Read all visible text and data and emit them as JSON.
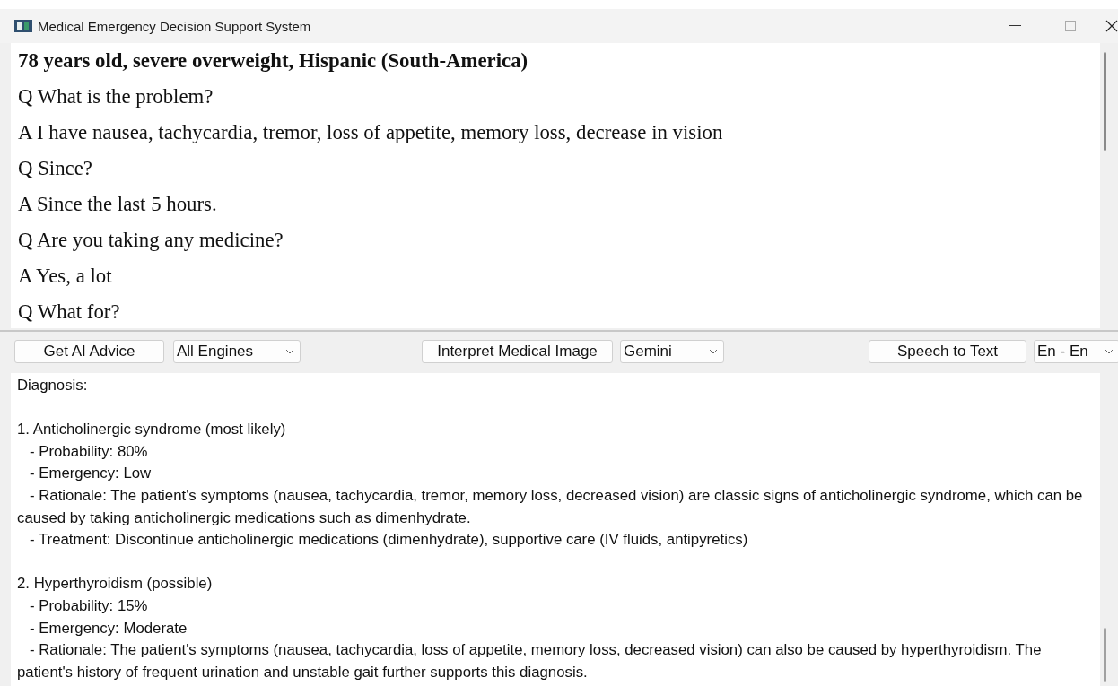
{
  "window": {
    "title": "Medical Emergency Decision Support System"
  },
  "conversation": {
    "header": "78 years old, severe overweight, Hispanic (South-America)",
    "lines": [
      "Q What is the problem?",
      "A I have nausea, tachycardia, tremor, loss of appetite, memory loss, decrease in vision",
      "Q Since?",
      "A Since the last 5 hours.",
      "Q Are you taking any medicine?",
      "A Yes, a lot",
      "Q What for?"
    ]
  },
  "toolbar": [
    {
      "kind": "button",
      "label": "Get AI Advice"
    },
    {
      "kind": "combo",
      "value": "All Engines"
    },
    {
      "kind": "button",
      "label": "Interpret Medical Image"
    },
    {
      "kind": "combo",
      "value": "Gemini"
    },
    {
      "kind": "button",
      "label": "Speech to Text"
    },
    {
      "kind": "combo",
      "value": "En - En"
    }
  ],
  "advice": {
    "heading": "Diagnosis:",
    "sections": [
      {
        "lines": [
          "1. Anticholinergic syndrome (most likely)",
          "   - Probability: 80%",
          "   - Emergency: Low",
          "   - Rationale: The patient's symptoms (nausea, tachycardia, tremor, memory loss, decreased vision) are classic signs of anticholinergic syndrome, which can be caused by taking anticholinergic medications such as dimenhydrate.",
          "   - Treatment: Discontinue anticholinergic medications (dimenhydrate), supportive care (IV fluids, antipyretics)"
        ]
      },
      {
        "lines": [
          "2. Hyperthyroidism (possible)",
          "   - Probability: 15%",
          "   - Emergency: Moderate",
          "   - Rationale: The patient's symptoms (nausea, tachycardia, loss of appetite, memory loss, decreased vision) can also be caused by hyperthyroidism. The patient's history of frequent urination and unstable gait further supports this diagnosis."
        ]
      }
    ]
  }
}
